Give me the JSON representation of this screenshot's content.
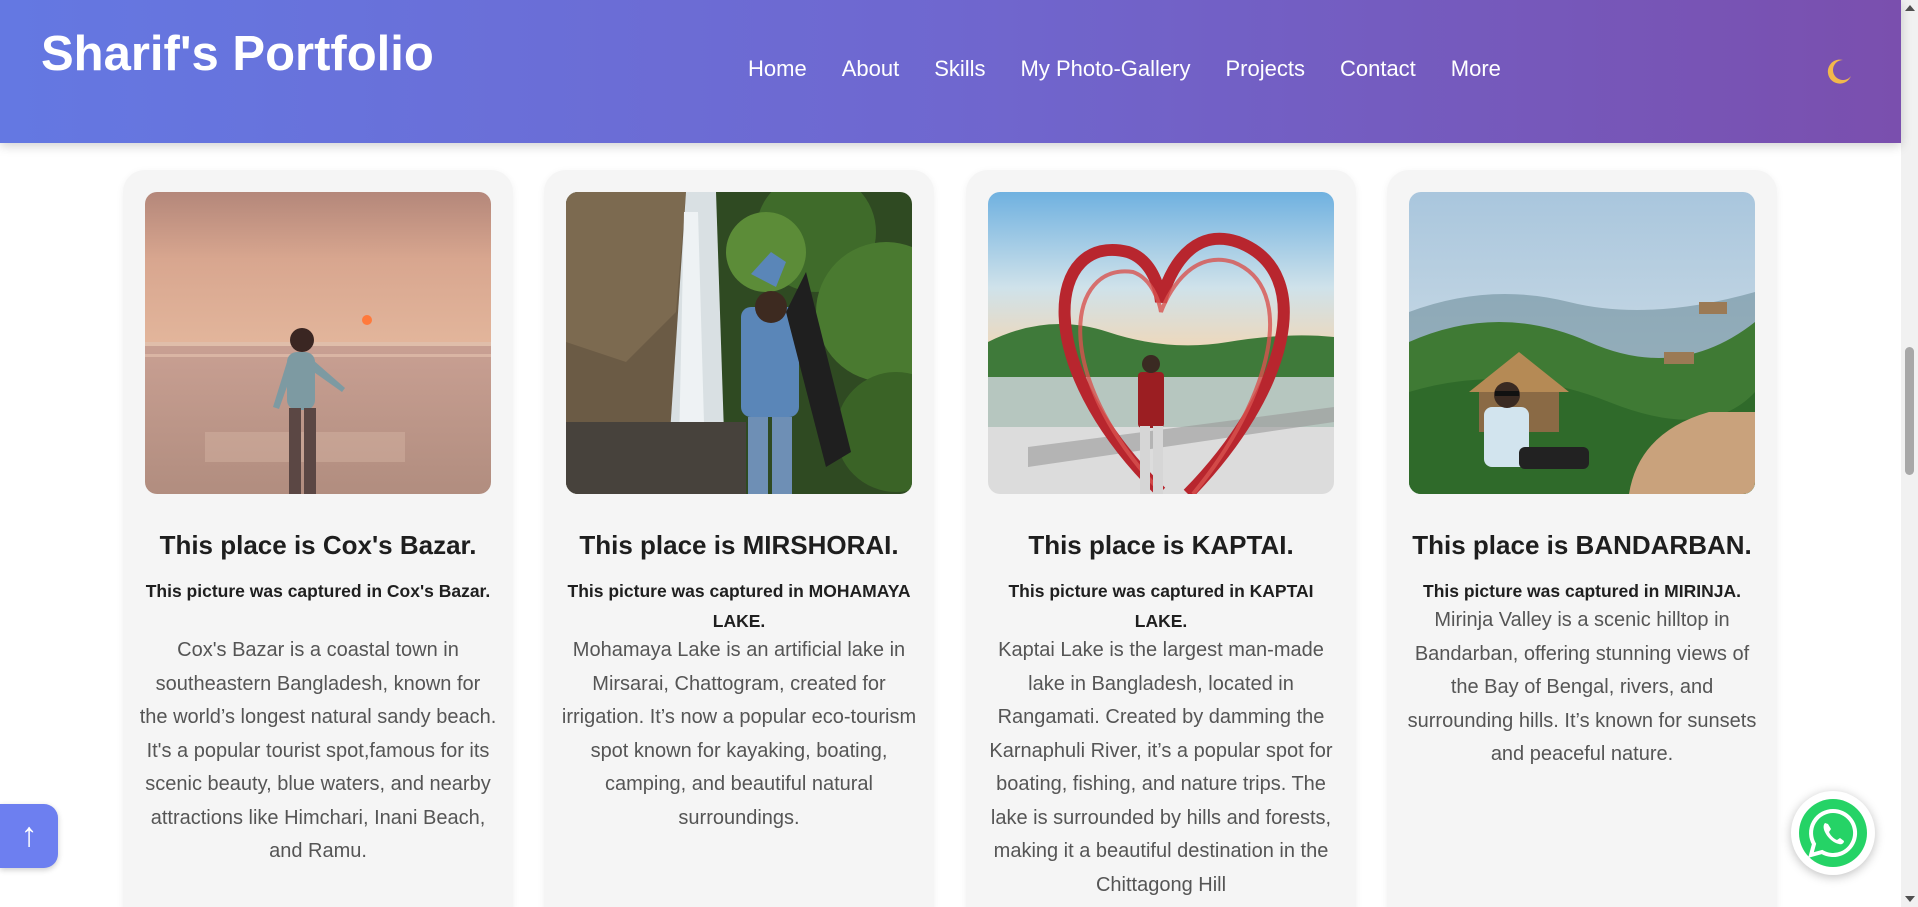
{
  "header": {
    "brand": "Sharif's Portfolio",
    "nav": [
      "Home",
      "About",
      "Skills",
      "My Photo-Gallery",
      "Projects",
      "Contact",
      "More"
    ],
    "theme_toggle_icon": "moon-icon"
  },
  "cards": [
    {
      "title": "This place is Cox's Bazar.",
      "caption": "This picture was captured in Cox's Bazar.",
      "description": "Cox's Bazar is a coastal town in southeastern Bangladesh, known for the world’s longest natural sandy beach. It's a popular tourist spot,famous for its scenic beauty, blue waters, and nearby attractions like Himchari, Inani Beach, and Ramu."
    },
    {
      "title": "This place is MIRSHORAI.",
      "caption": "This picture was captured in MOHAMAYA LAKE.",
      "description": "Mohamaya Lake is an artificial lake in Mirsarai, Chattogram, created for irrigation. It’s now a popular eco-tourism spot known for kayaking, boating, camping, and beautiful natural surroundings."
    },
    {
      "title": "This place is KAPTAI.",
      "caption": "This picture was captured in KAPTAI LAKE.",
      "description": "Kaptai Lake is the largest man-made lake in Bangladesh, located in Rangamati. Created by damming the Karnaphuli River, it’s a popular spot for boating, fishing, and nature trips. The lake is surrounded by hills and forests, making it a beautiful destination in the Chittagong Hill"
    },
    {
      "title": "This place is BANDARBAN.",
      "caption": "This picture was captured in MIRINJA.",
      "description": "Mirinja Valley is a scenic hilltop in Bandarban, offering stunning views of the Bay of Bengal, rivers, and surrounding hills. It’s known for sunsets and peaceful nature."
    }
  ],
  "scroll_top_button": "↑",
  "whatsapp_icon": "whatsapp-icon"
}
